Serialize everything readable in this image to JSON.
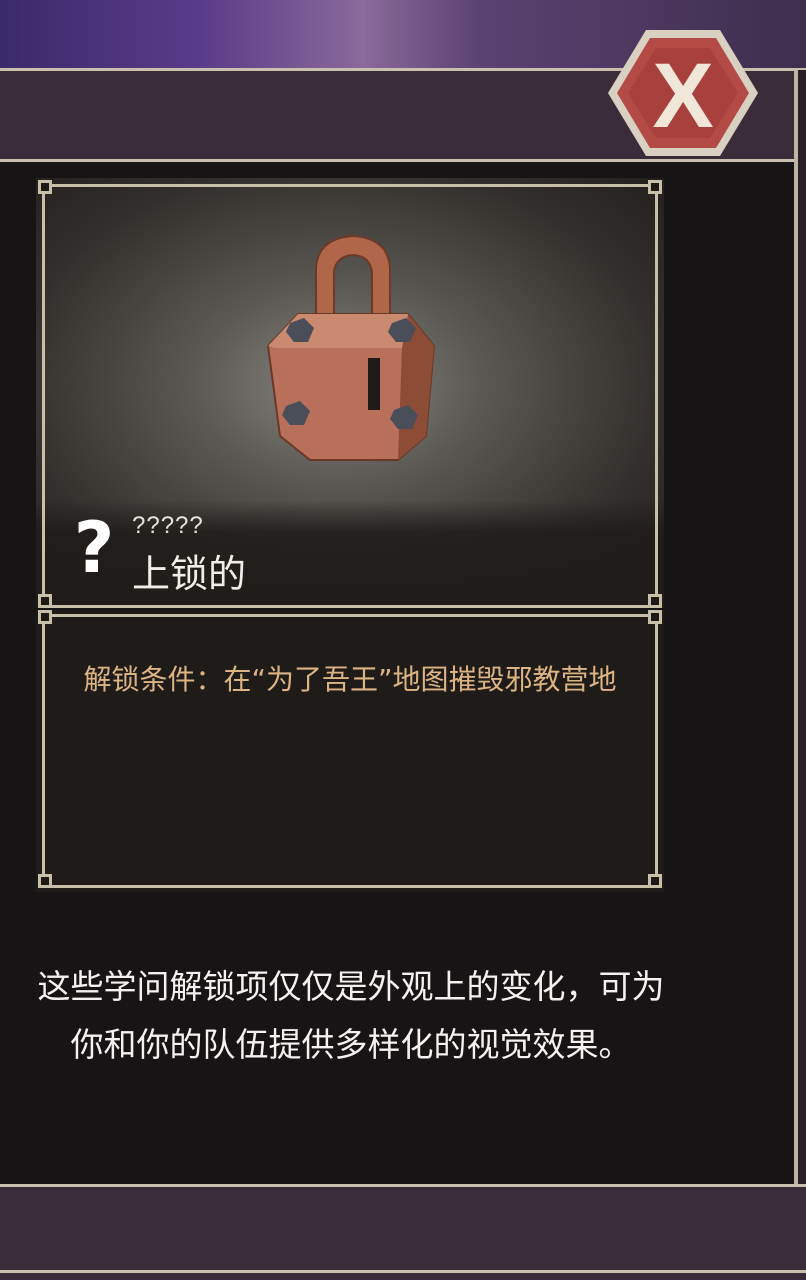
{
  "close_button": {
    "label": "X",
    "bg_color": "#b44a45",
    "icon": "close-icon"
  },
  "item": {
    "sub_label": "?????",
    "name": "上锁的",
    "icon": "question-mark-icon",
    "image": "padlock-icon"
  },
  "unlock_condition": "解锁条件：在“为了吾王”地图摧毁邪教营地",
  "description": "这些学问解锁项仅仅是外观上的变化，可为你和你的队伍提供多样化的视觉效果。",
  "colors": {
    "accent": "#dcb483",
    "frame": "#c8bfa8",
    "bar": "#3b2c3a"
  }
}
